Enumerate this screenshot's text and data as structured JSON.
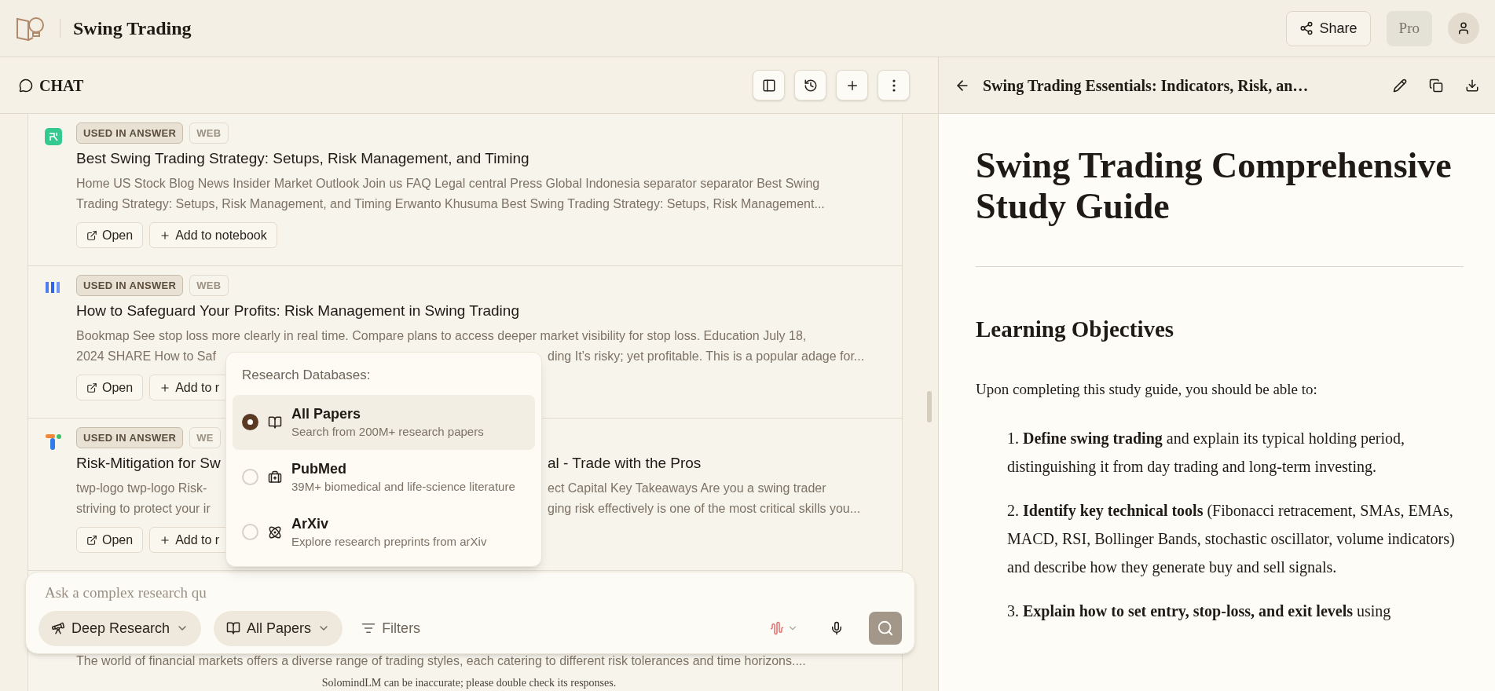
{
  "app": {
    "title": "Swing Trading",
    "share": "Share",
    "plan": "Pro"
  },
  "chat": {
    "title": "CHAT",
    "cards": [
      {
        "badges": [
          {
            "label": "USED IN ANSWER",
            "kind": "used"
          },
          {
            "label": "WEB",
            "kind": "source"
          }
        ],
        "title": [
          {
            "text": "Best Swing Trading Strategy: Setups, Risk Management, and Timing"
          }
        ],
        "summary": [
          [
            {
              "text": "Home US Stock Blog News Insider Market Outlook Join us FAQ Legal central Press Global Indonesia separator separator Best Swing"
            }
          ],
          [
            {
              "text": "Trading Strategy: Setups, Risk Management, and Timing Erwanto Khusuma Best Swing Trading Strategy: Setups, Risk Management..."
            }
          ]
        ],
        "buttons": [
          {
            "label": "Open",
            "kind": "open"
          },
          {
            "label": "Add to notebook",
            "kind": "add"
          }
        ]
      },
      {
        "badges": [
          {
            "label": "USED IN ANSWER",
            "kind": "used"
          },
          {
            "label": "WEB",
            "kind": "source"
          }
        ],
        "title": [
          {
            "text": "How to Safeguard Your Profits: Risk Management in Swing Trading"
          }
        ],
        "summary": [
          [
            {
              "text": "Bookmap See stop loss more clearly in real time. Compare plans to access deeper market visibility for stop loss. Education July 18,"
            }
          ],
          [
            {
              "text": "2024 SHARE How to Saf"
            },
            {
              "text": "ding It’s risky; yet profitable. This is a popular adage for..."
            }
          ]
        ],
        "buttons": [
          {
            "label": "Open",
            "kind": "open"
          },
          {
            "label": "Add to r",
            "kind": "add"
          }
        ]
      },
      {
        "badges": [
          {
            "label": "USED IN ANSWER",
            "kind": "used"
          },
          {
            "label": "WE",
            "kind": "source"
          }
        ],
        "title": [
          {
            "text": "Risk-Mitigation for Sw"
          },
          {
            "text": "al - Trade with the Pros"
          }
        ],
        "summary": [
          [
            {
              "text": "twp-logo twp-logo Risk-"
            },
            {
              "text": "ect Capital Key Takeaways Are you a swing trader"
            }
          ],
          [
            {
              "text": "striving to protect your ir"
            },
            {
              "text": "ging risk effectively is one of the most critical skills you..."
            }
          ]
        ],
        "buttons": [
          {
            "label": "Open",
            "kind": "open"
          },
          {
            "label": "Add to r",
            "kind": "add"
          }
        ]
      },
      {
        "summary": [
          [
            {
              "text": "The world of financial markets offers a diverse range of trading styles, each catering to different risk tolerances and time horizons...."
            }
          ]
        ]
      }
    ],
    "input": {
      "placeholder": "Ask a complex research qu",
      "controls": [
        {
          "label": "Deep Research",
          "kind": "mode"
        },
        {
          "label": "All Papers",
          "kind": "database"
        },
        {
          "label": "Filters",
          "kind": "filters"
        }
      ]
    },
    "disclaimer": "SolomindLM can be inaccurate; please double check its responses.",
    "database_menu": {
      "title": "Research Databases:",
      "options": [
        {
          "title": "All Papers",
          "description": "Search from 200M+ research papers",
          "kind": "papers",
          "selected": true
        },
        {
          "title": "PubMed",
          "description": "39M+ biomedical and life-science literature",
          "kind": "medical",
          "selected": false
        },
        {
          "title": "ArXiv",
          "description": "Explore research preprints from arXiv",
          "kind": "preprints",
          "selected": false
        }
      ]
    }
  },
  "document": {
    "header_title": "Swing Trading Essentials: Indicators, Risk, an…",
    "title": "Swing Trading Comprehensive Study Guide",
    "heading": "Learning Objectives",
    "intro": "Upon completing this study guide, you should be able to:",
    "objectives": [
      {
        "number": "1.",
        "text": "**Define swing trading** and explain its typical holding period, distinguishing it from day trading and long-term investing."
      },
      {
        "number": "2.",
        "text": "**Identify key technical tools** (Fibonacci retracement, SMAs, EMAs, MACD, RSI, Bollinger Bands, stochastic oscillator, volume indicators) and describe how they generate buy and sell signals."
      },
      {
        "number": "3.",
        "text": "**Explain how to set entry, stop-loss, and exit levels** using"
      }
    ]
  }
}
